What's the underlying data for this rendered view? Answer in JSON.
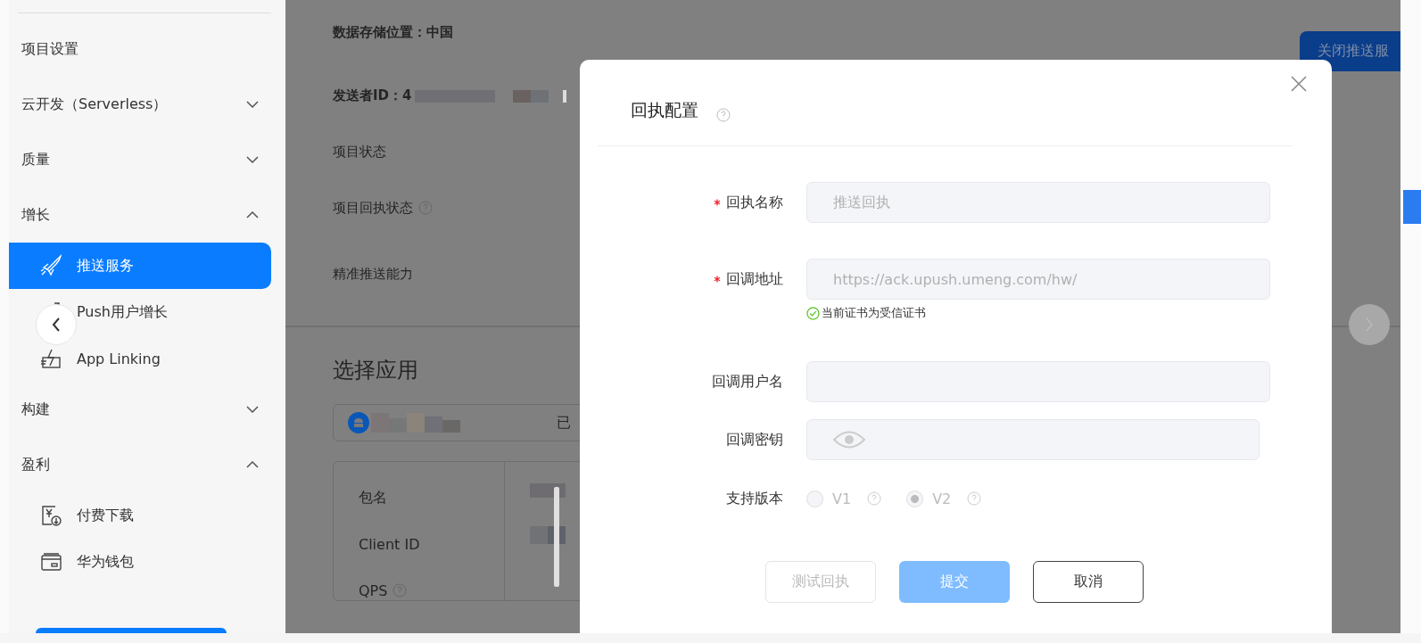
{
  "sidebar": {
    "items": [
      {
        "label": "项目设置",
        "kind": "link"
      },
      {
        "label": "云开发（Serverless）",
        "kind": "group",
        "expanded": false
      },
      {
        "label": "质量",
        "kind": "group",
        "expanded": false
      },
      {
        "label": "增长",
        "kind": "group",
        "expanded": true,
        "children": [
          {
            "label": "推送服务",
            "kind": "rocket",
            "selected": true
          },
          {
            "label": "Push用户增长",
            "kind": "growth",
            "selected": false
          },
          {
            "label": "App Linking",
            "kind": "linking",
            "selected": false
          }
        ]
      },
      {
        "label": "构建",
        "kind": "group",
        "expanded": false
      },
      {
        "label": "盈利",
        "kind": "group",
        "expanded": true,
        "children": [
          {
            "label": "付费下载",
            "kind": "yen",
            "selected": false
          },
          {
            "label": "华为钱包",
            "kind": "wallet",
            "selected": false
          }
        ]
      }
    ]
  },
  "main": {
    "storage": "数据存储位置：中国",
    "sender_id": "发送者ID：4",
    "info_rows": [
      {
        "label": "项目状态",
        "help": false
      },
      {
        "label": "项目回执状态",
        "help": true
      },
      {
        "label": "精准推送能力",
        "help": false
      }
    ],
    "close_button": "关闭推送服",
    "section_title": "选择应用",
    "app_status": "已",
    "table_rows": [
      {
        "label": "包名",
        "help": false
      },
      {
        "label": "Client ID",
        "help": false
      },
      {
        "label": "QPS",
        "help": true
      }
    ]
  },
  "dialog": {
    "title": "回执配置",
    "fields": [
      {
        "label": "回执名称",
        "required": true,
        "value": "推送回执",
        "kind": "text"
      },
      {
        "label": "回调地址",
        "required": true,
        "value": "https://ack.upush.umeng.com/hw/",
        "kind": "text",
        "hint": "当前证书为受信证书"
      },
      {
        "label": "回调用户名",
        "required": false,
        "kind": "text"
      },
      {
        "label": "回调密钥",
        "required": false,
        "kind": "password"
      }
    ],
    "version_label": "支持版本",
    "versions": [
      {
        "label": "V1",
        "selected": false
      },
      {
        "label": "V2",
        "selected": true
      }
    ],
    "buttons": [
      {
        "label": "测试回执",
        "kind": "default"
      },
      {
        "label": "提交",
        "kind": "primary"
      },
      {
        "label": "取消",
        "kind": "outline"
      }
    ]
  }
}
